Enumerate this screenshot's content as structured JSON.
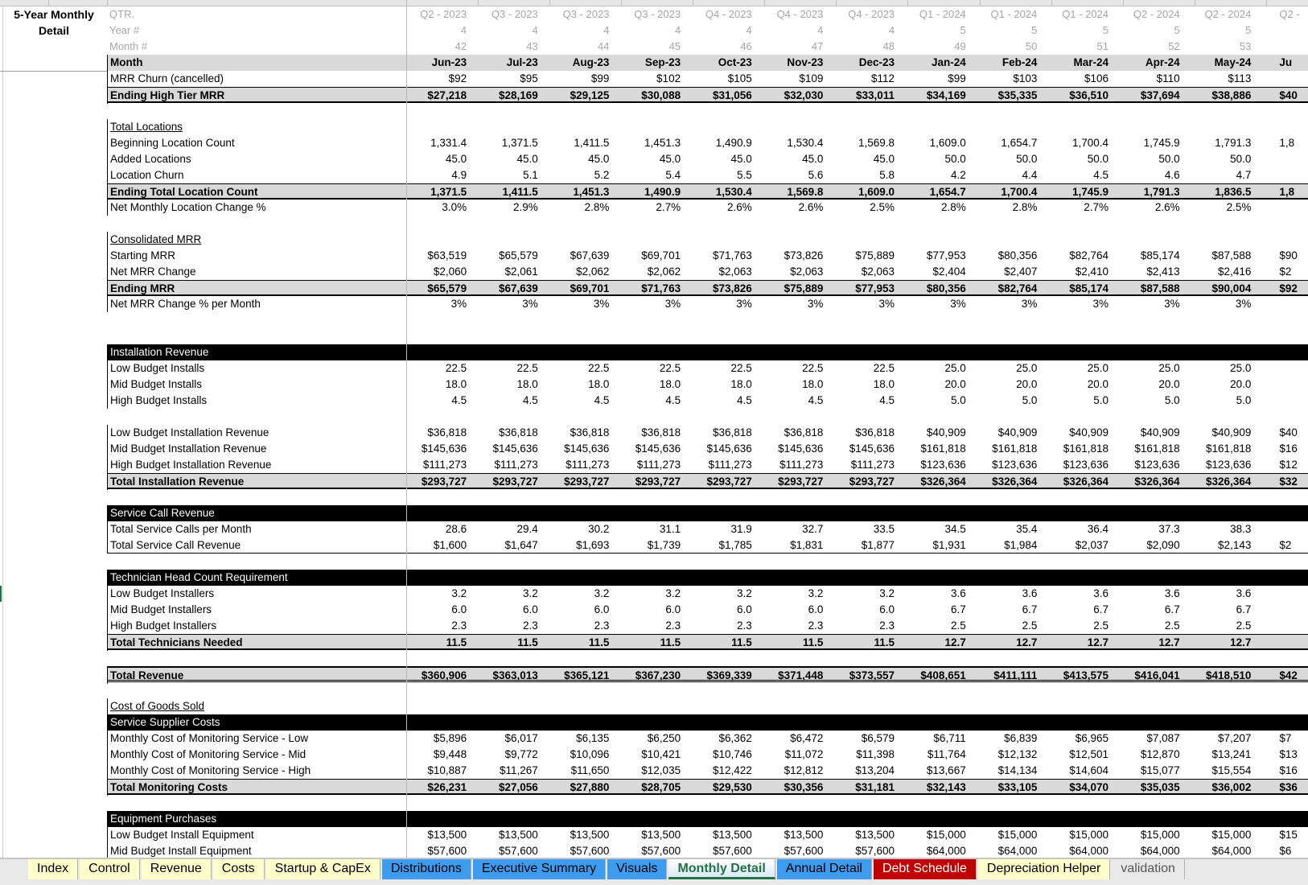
{
  "sheet_title": "5-Year Monthly Detail",
  "rows": [
    {
      "type": "hdr",
      "label": "QTR.",
      "values": [
        "Q2 - 2023",
        "Q3 - 2023",
        "Q3 - 2023",
        "Q3 - 2023",
        "Q4 - 2023",
        "Q4 - 2023",
        "Q4 - 2023",
        "Q1 - 2024",
        "Q1 - 2024",
        "Q1 - 2024",
        "Q2 - 2024",
        "Q2 - 2024"
      ],
      "partial": "Q2 -"
    },
    {
      "type": "hdr",
      "label": "Year #",
      "values": [
        "4",
        "4",
        "4",
        "4",
        "4",
        "4",
        "4",
        "5",
        "5",
        "5",
        "5",
        "5"
      ]
    },
    {
      "type": "hdr",
      "label": "Month #",
      "values": [
        "42",
        "43",
        "44",
        "45",
        "46",
        "47",
        "48",
        "49",
        "50",
        "51",
        "52",
        "53"
      ]
    },
    {
      "type": "month",
      "label": "Month",
      "values": [
        "Jun-23",
        "Jul-23",
        "Aug-23",
        "Sep-23",
        "Oct-23",
        "Nov-23",
        "Dec-23",
        "Jan-24",
        "Feb-24",
        "Mar-24",
        "Apr-24",
        "May-24"
      ],
      "partial": "Ju"
    },
    {
      "type": "normal",
      "label": "MRR Churn  (cancelled)",
      "values": [
        "$92",
        "$95",
        "$99",
        "$102",
        "$105",
        "$109",
        "$112",
        "$99",
        "$103",
        "$106",
        "$110",
        "$113"
      ]
    },
    {
      "type": "total",
      "label": "Ending High Tier MRR",
      "values": [
        "$27,218",
        "$28,169",
        "$29,125",
        "$30,088",
        "$31,056",
        "$32,030",
        "$33,011",
        "$34,169",
        "$35,335",
        "$36,510",
        "$37,694",
        "$38,886"
      ],
      "partial": "$40"
    },
    {
      "type": "blank"
    },
    {
      "type": "underline",
      "label": "Total Locations"
    },
    {
      "type": "normal",
      "label": "Beginning Location Count",
      "values": [
        "1,331.4",
        "1,371.5",
        "1,411.5",
        "1,451.3",
        "1,490.9",
        "1,530.4",
        "1,569.8",
        "1,609.0",
        "1,654.7",
        "1,700.4",
        "1,745.9",
        "1,791.3"
      ],
      "partial": "1,8"
    },
    {
      "type": "normal",
      "label": "Added Locations",
      "values": [
        "45.0",
        "45.0",
        "45.0",
        "45.0",
        "45.0",
        "45.0",
        "45.0",
        "50.0",
        "50.0",
        "50.0",
        "50.0",
        "50.0"
      ]
    },
    {
      "type": "normal",
      "label": "Location Churn",
      "values": [
        "4.9",
        "5.1",
        "5.2",
        "5.4",
        "5.5",
        "5.6",
        "5.8",
        "4.2",
        "4.4",
        "4.5",
        "4.6",
        "4.7"
      ]
    },
    {
      "type": "total",
      "label": "Ending Total Location Count",
      "values": [
        "1,371.5",
        "1,411.5",
        "1,451.3",
        "1,490.9",
        "1,530.4",
        "1,569.8",
        "1,609.0",
        "1,654.7",
        "1,700.4",
        "1,745.9",
        "1,791.3",
        "1,836.5"
      ],
      "partial": "1,8"
    },
    {
      "type": "normal",
      "label": "Net Monthly Location Change %",
      "values": [
        "3.0%",
        "2.9%",
        "2.8%",
        "2.7%",
        "2.6%",
        "2.6%",
        "2.5%",
        "2.8%",
        "2.8%",
        "2.7%",
        "2.6%",
        "2.5%"
      ]
    },
    {
      "type": "blank"
    },
    {
      "type": "underline",
      "label": "Consolidated MRR"
    },
    {
      "type": "normal",
      "label": "Starting MRR",
      "values": [
        "$63,519",
        "$65,579",
        "$67,639",
        "$69,701",
        "$71,763",
        "$73,826",
        "$75,889",
        "$77,953",
        "$80,356",
        "$82,764",
        "$85,174",
        "$87,588"
      ],
      "partial": "$90"
    },
    {
      "type": "normal",
      "label": "Net MRR Change",
      "values": [
        "$2,060",
        "$2,061",
        "$2,062",
        "$2,062",
        "$2,063",
        "$2,063",
        "$2,063",
        "$2,404",
        "$2,407",
        "$2,410",
        "$2,413",
        "$2,416"
      ],
      "partial": "$2"
    },
    {
      "type": "total",
      "label": "Ending MRR",
      "values": [
        "$65,579",
        "$67,639",
        "$69,701",
        "$71,763",
        "$73,826",
        "$75,889",
        "$77,953",
        "$80,356",
        "$82,764",
        "$85,174",
        "$87,588",
        "$90,004"
      ],
      "partial": "$92"
    },
    {
      "type": "normal",
      "label": "Net MRR Change % per Month",
      "values": [
        "3%",
        "3%",
        "3%",
        "3%",
        "3%",
        "3%",
        "3%",
        "3%",
        "3%",
        "3%",
        "3%",
        "3%"
      ]
    },
    {
      "type": "blank"
    },
    {
      "type": "blank"
    },
    {
      "type": "section",
      "label": "Installation Revenue"
    },
    {
      "type": "normal",
      "label": "Low Budget Installs",
      "values": [
        "22.5",
        "22.5",
        "22.5",
        "22.5",
        "22.5",
        "22.5",
        "22.5",
        "25.0",
        "25.0",
        "25.0",
        "25.0",
        "25.0"
      ]
    },
    {
      "type": "normal",
      "label": "Mid Budget Installs",
      "values": [
        "18.0",
        "18.0",
        "18.0",
        "18.0",
        "18.0",
        "18.0",
        "18.0",
        "20.0",
        "20.0",
        "20.0",
        "20.0",
        "20.0"
      ]
    },
    {
      "type": "normal",
      "label": "High Budget Installs",
      "values": [
        "4.5",
        "4.5",
        "4.5",
        "4.5",
        "4.5",
        "4.5",
        "4.5",
        "5.0",
        "5.0",
        "5.0",
        "5.0",
        "5.0"
      ]
    },
    {
      "type": "blank"
    },
    {
      "type": "normal",
      "label": "Low Budget Installation Revenue",
      "values": [
        "$36,818",
        "$36,818",
        "$36,818",
        "$36,818",
        "$36,818",
        "$36,818",
        "$36,818",
        "$40,909",
        "$40,909",
        "$40,909",
        "$40,909",
        "$40,909"
      ],
      "partial": "$40"
    },
    {
      "type": "normal",
      "label": "Mid Budget Installation Revenue",
      "values": [
        "$145,636",
        "$145,636",
        "$145,636",
        "$145,636",
        "$145,636",
        "$145,636",
        "$145,636",
        "$161,818",
        "$161,818",
        "$161,818",
        "$161,818",
        "$161,818"
      ],
      "partial": "$16"
    },
    {
      "type": "normal",
      "label": "High Budget Installation Revenue",
      "values": [
        "$111,273",
        "$111,273",
        "$111,273",
        "$111,273",
        "$111,273",
        "$111,273",
        "$111,273",
        "$123,636",
        "$123,636",
        "$123,636",
        "$123,636",
        "$123,636"
      ],
      "partial": "$12"
    },
    {
      "type": "total",
      "label": "Total Installation Revenue",
      "values": [
        "$293,727",
        "$293,727",
        "$293,727",
        "$293,727",
        "$293,727",
        "$293,727",
        "$293,727",
        "$326,364",
        "$326,364",
        "$326,364",
        "$326,364",
        "$326,364"
      ],
      "partial": "$32"
    },
    {
      "type": "blank"
    },
    {
      "type": "section",
      "label": "Service Call Revenue"
    },
    {
      "type": "normal",
      "label": "Total Service Calls per Month",
      "values": [
        "28.6",
        "29.4",
        "30.2",
        "31.1",
        "31.9",
        "32.7",
        "33.5",
        "34.5",
        "35.4",
        "36.4",
        "37.3",
        "38.3"
      ]
    },
    {
      "type": "bline",
      "label": "Total Service Call Revenue",
      "values": [
        "$1,600",
        "$1,647",
        "$1,693",
        "$1,739",
        "$1,785",
        "$1,831",
        "$1,877",
        "$1,931",
        "$1,984",
        "$2,037",
        "$2,090",
        "$2,143"
      ],
      "partial": "$2"
    },
    {
      "type": "blank"
    },
    {
      "type": "section",
      "label": "Technician Head Count Requirement"
    },
    {
      "type": "normal",
      "label": "Low Budget Installers",
      "values": [
        "3.2",
        "3.2",
        "3.2",
        "3.2",
        "3.2",
        "3.2",
        "3.2",
        "3.6",
        "3.6",
        "3.6",
        "3.6",
        "3.6"
      ]
    },
    {
      "type": "normal",
      "label": "Mid Budget Installers",
      "values": [
        "6.0",
        "6.0",
        "6.0",
        "6.0",
        "6.0",
        "6.0",
        "6.0",
        "6.7",
        "6.7",
        "6.7",
        "6.7",
        "6.7"
      ]
    },
    {
      "type": "normal",
      "label": "High Budget Installers",
      "values": [
        "2.3",
        "2.3",
        "2.3",
        "2.3",
        "2.3",
        "2.3",
        "2.3",
        "2.5",
        "2.5",
        "2.5",
        "2.5",
        "2.5"
      ]
    },
    {
      "type": "total",
      "label": "Total Technicians Needed",
      "values": [
        "11.5",
        "11.5",
        "11.5",
        "11.5",
        "11.5",
        "11.5",
        "11.5",
        "12.7",
        "12.7",
        "12.7",
        "12.7",
        "12.7"
      ]
    },
    {
      "type": "blank"
    },
    {
      "type": "grand",
      "label": "Total Revenue",
      "values": [
        "$360,906",
        "$363,013",
        "$365,121",
        "$367,230",
        "$369,339",
        "$371,448",
        "$373,557",
        "$408,651",
        "$411,111",
        "$413,575",
        "$416,041",
        "$418,510"
      ],
      "partial": "$42"
    },
    {
      "type": "blank"
    },
    {
      "type": "underline",
      "label": "Cost of Goods Sold"
    },
    {
      "type": "section",
      "label": "Service Supplier Costs"
    },
    {
      "type": "normal",
      "label": "Monthly Cost of Monitoring Service - Low",
      "values": [
        "$5,896",
        "$6,017",
        "$6,135",
        "$6,250",
        "$6,362",
        "$6,472",
        "$6,579",
        "$6,711",
        "$6,839",
        "$6,965",
        "$7,087",
        "$7,207"
      ],
      "partial": "$7"
    },
    {
      "type": "normal",
      "label": "Monthly Cost of Monitoring Service - Mid",
      "values": [
        "$9,448",
        "$9,772",
        "$10,096",
        "$10,421",
        "$10,746",
        "$11,072",
        "$11,398",
        "$11,764",
        "$12,132",
        "$12,501",
        "$12,870",
        "$13,241"
      ],
      "partial": "$13"
    },
    {
      "type": "normal",
      "label": "Monthly Cost of Monitoring Service - High",
      "values": [
        "$10,887",
        "$11,267",
        "$11,650",
        "$12,035",
        "$12,422",
        "$12,812",
        "$13,204",
        "$13,667",
        "$14,134",
        "$14,604",
        "$15,077",
        "$15,554"
      ],
      "partial": "$16"
    },
    {
      "type": "total",
      "label": "Total Monitoring Costs",
      "values": [
        "$26,231",
        "$27,056",
        "$27,880",
        "$28,705",
        "$29,530",
        "$30,356",
        "$31,181",
        "$32,143",
        "$33,105",
        "$34,070",
        "$35,035",
        "$36,002"
      ],
      "partial": "$36"
    },
    {
      "type": "blank"
    },
    {
      "type": "section",
      "label": "Equipment Purchases"
    },
    {
      "type": "normal",
      "label": "Low Budget Install Equipment",
      "values": [
        "$13,500",
        "$13,500",
        "$13,500",
        "$13,500",
        "$13,500",
        "$13,500",
        "$13,500",
        "$15,000",
        "$15,000",
        "$15,000",
        "$15,000",
        "$15,000"
      ],
      "partial": "$15"
    },
    {
      "type": "normal",
      "label": "Mid Budget Install Equipment",
      "values": [
        "$57,600",
        "$57,600",
        "$57,600",
        "$57,600",
        "$57,600",
        "$57,600",
        "$57,600",
        "$64,000",
        "$64,000",
        "$64,000",
        "$64,000",
        "$64,000"
      ],
      "partial": "$6"
    }
  ],
  "tabs": [
    {
      "label": "Index",
      "color": "yellow"
    },
    {
      "label": "Control",
      "color": "yellow"
    },
    {
      "label": "Revenue",
      "color": "yellow"
    },
    {
      "label": "Costs",
      "color": "yellow"
    },
    {
      "label": "Startup & CapEx",
      "color": "yellow"
    },
    {
      "label": "Distributions",
      "color": "blue"
    },
    {
      "label": "Executive Summary",
      "color": "blue"
    },
    {
      "label": "Visuals",
      "color": "blue"
    },
    {
      "label": "Monthly Detail",
      "color": "active",
      "active": true
    },
    {
      "label": "Annual Detail",
      "color": "blue"
    },
    {
      "label": "Debt Schedule",
      "color": "red"
    },
    {
      "label": "Depreciation Helper",
      "color": "yellow"
    },
    {
      "label": "validation",
      "color": "plain"
    }
  ],
  "colors": {
    "tab_yellow": "#ffffcc",
    "tab_blue": "#3d9bf0",
    "tab_red": "#c00000",
    "active_green": "#217346",
    "total_fill": "#d9d9d9",
    "section_fill": "#000000"
  }
}
